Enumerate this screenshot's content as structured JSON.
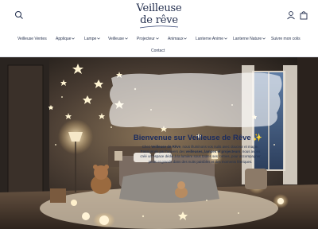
{
  "header": {
    "logo_line1": "Veilleuse",
    "logo_line2": "de rêve",
    "icons": {
      "search": "search-icon",
      "account": "user-icon",
      "cart": "bag-icon"
    }
  },
  "nav": {
    "items": [
      {
        "label": "Veilleuse Ventes"
      },
      {
        "label": "Applique"
      },
      {
        "label": "Lampe"
      },
      {
        "label": "Veilleuse"
      },
      {
        "label": "Projecteur"
      },
      {
        "label": "Animaux"
      },
      {
        "label": "Lanterne Anime"
      },
      {
        "label": "Lanterne Nature"
      },
      {
        "label": "Suivre mon colis"
      },
      {
        "label": "Contact"
      }
    ]
  },
  "hero": {
    "title": "Bienvenue sur Veilleuse de Rêve ✨",
    "line1_a": "Chez ",
    "line1_b": "Veilleuse de Rêve",
    "line1_c": ", nous illuminons vos nuits avec douceur et magie.",
    "line2_a": "Passionnés par l'univers des ",
    "line2_b": "veilleuses, lampes et projecteurs",
    "line2_c": ", nous avons",
    "line3": "créé un espace dédié à la lumière sous toutes ses formes, pour accompagner",
    "line4": "petits et grands dans des nuits paisibles et des moments féeriques."
  },
  "colors": {
    "navy": "#1e2a4a",
    "title_blue": "#1a2b5f",
    "wall": "#3d3530",
    "glow": "#f7d9a0"
  }
}
